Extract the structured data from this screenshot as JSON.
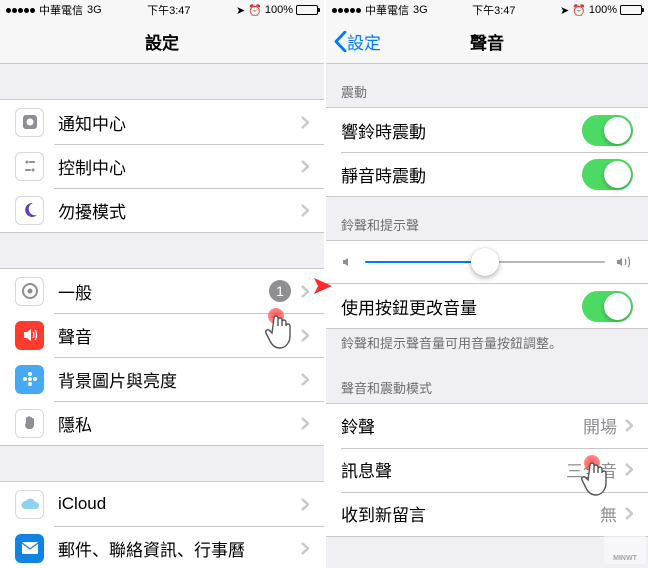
{
  "statusbar": {
    "carrier": "中華電信",
    "network": "3G",
    "time": "下午3:47",
    "battery_pct": "100%"
  },
  "left": {
    "title": "設定",
    "groups": [
      [
        {
          "id": "notif",
          "label": "通知中心"
        },
        {
          "id": "control",
          "label": "控制中心"
        },
        {
          "id": "dnd",
          "label": "勿擾模式"
        }
      ],
      [
        {
          "id": "general",
          "label": "一般",
          "badge": "1"
        },
        {
          "id": "sound",
          "label": "聲音"
        },
        {
          "id": "wallpaper",
          "label": "背景圖片與亮度"
        },
        {
          "id": "privacy",
          "label": "隱私"
        }
      ],
      [
        {
          "id": "icloud",
          "label": "iCloud"
        },
        {
          "id": "mail",
          "label": "郵件、聯絡資訊、行事曆"
        }
      ]
    ]
  },
  "right": {
    "back": "設定",
    "title": "聲音",
    "section_vibrate": "震動",
    "vibrate_ring": "響鈴時震動",
    "vibrate_silent": "靜音時震動",
    "section_ringer": "鈴聲和提示聲",
    "change_with_buttons": "使用按鈕更改音量",
    "ringer_footer": "鈴聲和提示聲音量可用音量按鈕調整。",
    "section_sounds": "聲音和震動模式",
    "rows": [
      {
        "label": "鈴聲",
        "value": "開場"
      },
      {
        "label": "訊息聲",
        "value": "三全音"
      },
      {
        "label": "收到新留言",
        "value": "無"
      }
    ],
    "slider_pct": 50
  }
}
